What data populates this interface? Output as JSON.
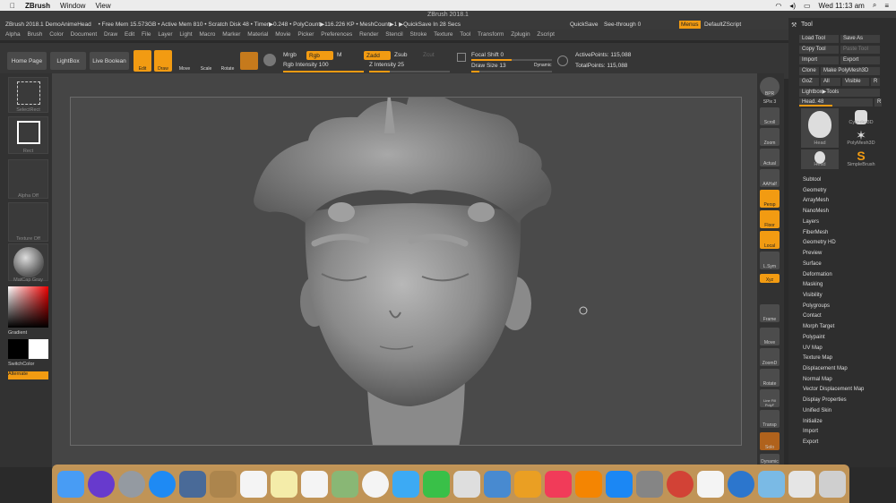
{
  "mac": {
    "app": "ZBrush",
    "menus": [
      "Window",
      "View"
    ],
    "clock": "Wed 11:13 am"
  },
  "title": "ZBrush 2018.1",
  "info": {
    "doc": "ZBrush 2018.1 DemoAnimeHead",
    "mem": "• Free Mem 15.573GB • Active Mem 810 • Scratch Disk 48 • Timer▶0.248 • PolyCount▶116.226 KP • MeshCount▶1 ▶QuickSave In 28 Secs",
    "quicksave": "QuickSave",
    "seethrough": "See-through  0",
    "menus_btn": "Menus",
    "default_zscript": "DefaultZScript"
  },
  "menubar": [
    "Alpha",
    "Brush",
    "Color",
    "Document",
    "Draw",
    "Edit",
    "File",
    "Layer",
    "Light",
    "Macro",
    "Marker",
    "Material",
    "Movie",
    "Picker",
    "Preferences",
    "Render",
    "Stencil",
    "Stroke",
    "Texture",
    "Tool",
    "Transform",
    "Zplugin",
    "Zscript"
  ],
  "toolbar": {
    "home": "Home Page",
    "lightbox": "LightBox",
    "liveboolean": "Live Boolean",
    "edit": "Edit",
    "draw": "Draw",
    "move": "Move",
    "scale": "Scale",
    "rotate": "Rotate",
    "mrgb": "Mrgb",
    "rgb": "Rgb",
    "m": "M",
    "rgb_intensity": "Rgb Intensity 100",
    "zadd": "Zadd",
    "zsub": "Zsub",
    "zcut": "Zcut",
    "z_intensity": "Z Intensity 25",
    "focal_shift": "Focal Shift 0",
    "draw_size": "Draw Size 13",
    "dynamic": "Dynamic",
    "active_points": "ActivePoints: 115,088",
    "total_points": "TotalPoints: 115,088",
    "rgb_intensity_level": 1.0,
    "z_intensity_level": 0.25,
    "draw_size_level": 0.1
  },
  "leftshelf": {
    "selectrect": "SelectRect",
    "rect": "Rect",
    "alpha": "Alpha Off",
    "texture": "Texture Off",
    "matcap": "MatCap Gray",
    "gradient": "Gradient",
    "switchcolor": "SwitchColor",
    "alternate": "Alternate"
  },
  "rightshelf": [
    "BPR",
    "SPix 3",
    "Scroll",
    "Zoom",
    "Actual",
    "AAHalf",
    "Persp",
    "Floor",
    "Local",
    "L.Sym",
    "Xyz",
    "Frame",
    "Move",
    "ZoomD",
    "Rotate",
    "Line Fill PolyF",
    "Transp",
    "Solo",
    "Dynamic"
  ],
  "toolpanel": {
    "header": "Tool",
    "load": "Load Tool",
    "saveas": "Save As",
    "copy": "Copy Tool",
    "paste": "Paste Tool",
    "import": "Import",
    "export": "Export",
    "clone": "Clone",
    "make": "Make PolyMesh3D",
    "goz": "GoZ",
    "all": "All",
    "visible": "Visible",
    "r": "R",
    "lightbox_tools": "Lightbox▶Tools",
    "head_label": "Head. 48",
    "head_level": 0.45,
    "thumbs": [
      "Head",
      "Cylinder3D",
      "PolyMesh3D",
      "Head",
      "SimpleBrush"
    ],
    "items": [
      "Subtool",
      "Geometry",
      "ArrayMesh",
      "NanoMesh",
      "Layers",
      "FiberMesh",
      "Geometry HD",
      "Preview",
      "Surface",
      "Deformation",
      "Masking",
      "Visibility",
      "Polygroups",
      "Contact",
      "Morph Target",
      "Polypaint",
      "UV Map",
      "Texture Map",
      "Displacement Map",
      "Normal Map",
      "Vector Displacement Map",
      "Display Properties",
      "Unified Skin",
      "Initialize",
      "Import",
      "Export"
    ]
  },
  "colors": {
    "accent": "#f29b12",
    "bg": "#2a2a2a",
    "canvas": "#4a4a4a"
  }
}
